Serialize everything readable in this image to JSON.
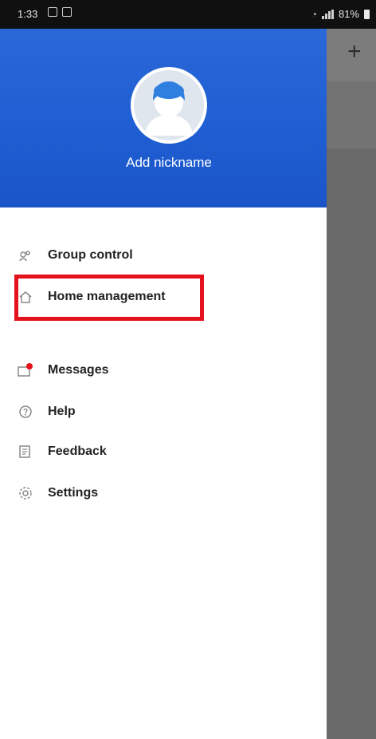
{
  "status_bar": {
    "time": "1:33",
    "battery": "81%"
  },
  "drawer": {
    "profile": {
      "nickname_label": "Add nickname"
    },
    "menu": [
      {
        "label": "Group control",
        "icon": "group-control-icon"
      },
      {
        "label": "Home management",
        "icon": "home-icon"
      },
      {
        "label": "Messages",
        "icon": "messages-icon"
      },
      {
        "label": "Help",
        "icon": "help-icon"
      },
      {
        "label": "Feedback",
        "icon": "feedback-icon"
      },
      {
        "label": "Settings",
        "icon": "settings-icon"
      }
    ]
  },
  "colors": {
    "header_blue": "#1f5ed3",
    "highlight_red": "#e3121c",
    "message_badge": "#e3121c"
  },
  "background": {
    "add_button": "+"
  }
}
